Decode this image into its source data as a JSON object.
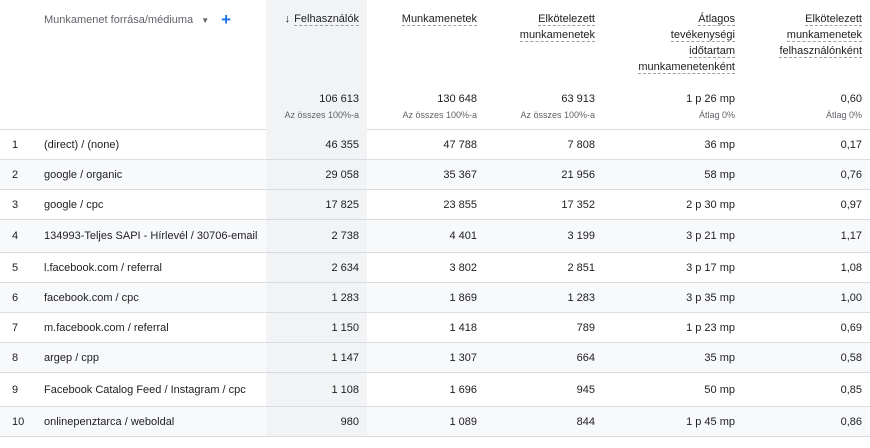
{
  "header": {
    "dimension_label": "Munkamenet forrása/médiuma",
    "columns": [
      {
        "title_lines": [
          "Felhasználók"
        ],
        "sorted": true,
        "total": "106 613",
        "sub": "Az összes 100%-a"
      },
      {
        "title_lines": [
          "Munkamenetek"
        ],
        "sorted": false,
        "total": "130 648",
        "sub": "Az összes 100%-a"
      },
      {
        "title_lines": [
          "Elkötelezett",
          "munkamenetek"
        ],
        "sorted": false,
        "total": "63 913",
        "sub": "Az összes 100%-a"
      },
      {
        "title_lines": [
          "Átlagos",
          "tevékenységi",
          "időtartam",
          "munkamenetenként"
        ],
        "sorted": false,
        "total": "1 p 26 mp",
        "sub": "Átlag 0%"
      },
      {
        "title_lines": [
          "Elkötelezett",
          "munkamenetek",
          "felhasználónként"
        ],
        "sorted": false,
        "total": "0,60",
        "sub": "Átlag 0%"
      }
    ]
  },
  "rows": [
    {
      "idx": "1",
      "dim": "(direct) / (none)",
      "vals": [
        "46 355",
        "47 788",
        "7 808",
        "36 mp",
        "0,17"
      ]
    },
    {
      "idx": "2",
      "dim": "google / organic",
      "vals": [
        "29 058",
        "35 367",
        "21 956",
        "58 mp",
        "0,76"
      ]
    },
    {
      "idx": "3",
      "dim": "google / cpc",
      "vals": [
        "17 825",
        "23 855",
        "17 352",
        "2 p 30 mp",
        "0,97"
      ]
    },
    {
      "idx": "4",
      "dim": "134993-Teljes SAPI - Hírlevél / 30706-email",
      "vals": [
        "2 738",
        "4 401",
        "3 199",
        "3 p 21 mp",
        "1,17"
      ]
    },
    {
      "idx": "5",
      "dim": "l.facebook.com / referral",
      "vals": [
        "2 634",
        "3 802",
        "2 851",
        "3 p 17 mp",
        "1,08"
      ]
    },
    {
      "idx": "6",
      "dim": "facebook.com / cpc",
      "vals": [
        "1 283",
        "1 869",
        "1 283",
        "3 p 35 mp",
        "1,00"
      ]
    },
    {
      "idx": "7",
      "dim": "m.facebook.com / referral",
      "vals": [
        "1 150",
        "1 418",
        "789",
        "1 p 23 mp",
        "0,69"
      ]
    },
    {
      "idx": "8",
      "dim": "argep / cpp",
      "vals": [
        "1 147",
        "1 307",
        "664",
        "35 mp",
        "0,58"
      ]
    },
    {
      "idx": "9",
      "dim": "Facebook Catalog Feed / Instagram / cpc",
      "vals": [
        "1 108",
        "1 696",
        "945",
        "50 mp",
        "0,85"
      ]
    },
    {
      "idx": "10",
      "dim": "onlinepenztarca / weboldal",
      "vals": [
        "980",
        "1 089",
        "844",
        "1 p 45 mp",
        "0,86"
      ]
    }
  ],
  "icons": {
    "sort": "arrow-down-icon",
    "dropdown": "caret-down-icon",
    "add": "plus-icon"
  },
  "colors": {
    "accent": "#1a73e8",
    "sorted_column_bg": "#f1f3f4",
    "border": "#dadce0"
  }
}
